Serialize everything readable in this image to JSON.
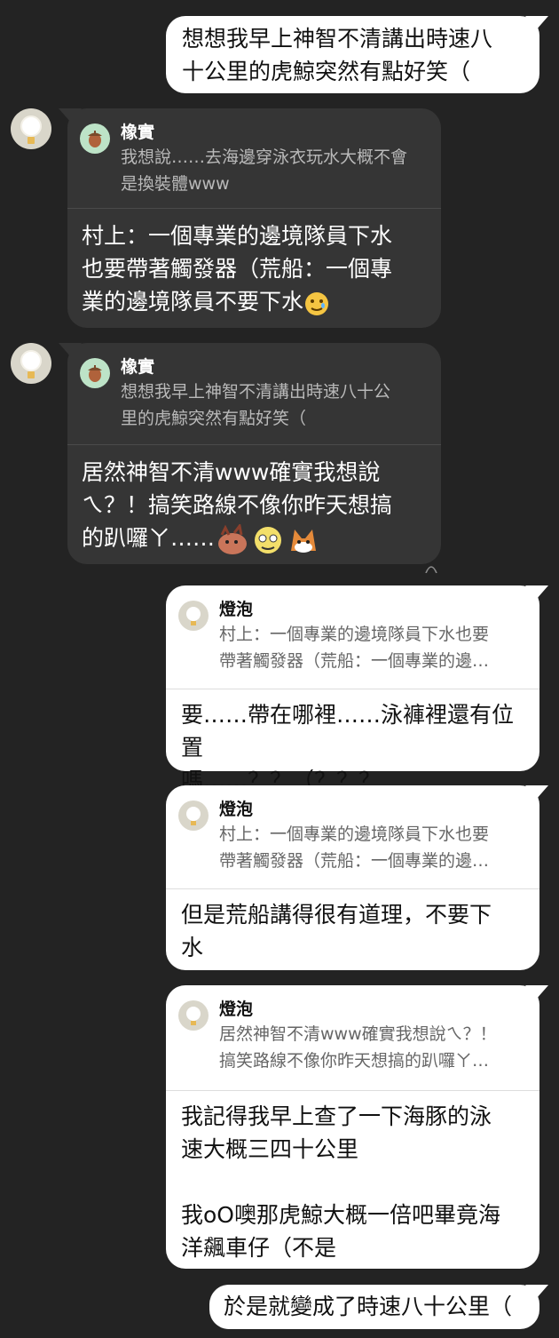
{
  "messages": {
    "m1": {
      "text": "想想我早上神智不清講出時速八\n十公里的虎鯨突然有點好笑（"
    },
    "m2": {
      "quote_name": "橡實",
      "quote_text": "我想說……去海邊穿泳衣玩水大概不會\n是換裝體www",
      "text": "村上：一個專業的邊境隊員下水\n也要帶著觸發器（荒船：一個專\n業的邊境隊員不要下水"
    },
    "m3": {
      "quote_name": "橡實",
      "quote_text": "想想我早上神智不清講出時速八十公\n里的虎鯨突然有點好笑（",
      "text": "居然神智不清www確實我想說\nㄟ？！搞笑路線不像你昨天想搞\n的趴囉ㄚ……"
    },
    "m4": {
      "quote_name": "燈泡",
      "quote_text": "村上：一個專業的邊境隊員下水也要\n帶著觸發器（荒船：一個專業的邊…",
      "text": "要……帶在哪裡……泳褲裡還有位置\n嗎……？？（？？？"
    },
    "m5": {
      "quote_name": "燈泡",
      "quote_text": "村上：一個專業的邊境隊員下水也要\n帶著觸發器（荒船：一個專業的邊…",
      "text": "但是荒船講得很有道理，不要下\n水"
    },
    "m6": {
      "quote_name": "燈泡",
      "quote_text": "居然神智不清www確實我想說ㄟ？！\n搞笑路線不像你昨天想搞的趴囉ㄚ…",
      "text": "我記得我早上查了一下海豚的泳\n速大概三四十公里\n\n我oO噢那虎鯨大概一倍吧畢竟海\n洋飆車仔（不是"
    },
    "m7": {
      "text": "於是就變成了時速八十公里（"
    }
  },
  "colors": {
    "background": "#232323",
    "outgoing_bubble": "#ffffff",
    "incoming_bubble": "#353535",
    "acorn_icon_bg": "#bde3c7",
    "bulb_avatar_bg": "#d9d6ca"
  },
  "icons": {
    "bulb_avatar": "lightbulb-avatar-icon",
    "acorn": "acorn-icon",
    "sticker_emojis": [
      "teary-smile-emoji",
      "sticker-hedgehog",
      "sticker-round-face",
      "sticker-fox"
    ]
  }
}
